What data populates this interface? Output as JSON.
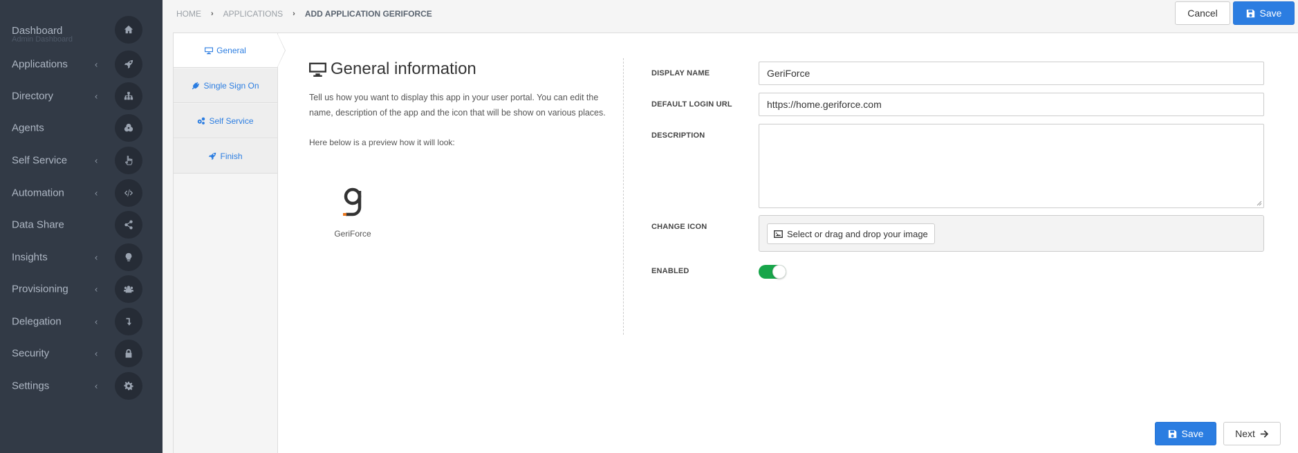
{
  "sidebar": {
    "dashboard": {
      "label": "Dashboard",
      "sub": "Admin Dashboard",
      "icon": "home-icon"
    },
    "items": [
      {
        "label": "Applications",
        "has_chevron": true,
        "icon": "rocket-icon"
      },
      {
        "label": "Directory",
        "has_chevron": true,
        "icon": "sitemap-icon"
      },
      {
        "label": "Agents",
        "has_chevron": false,
        "icon": "cogs-icon"
      },
      {
        "label": "Self Service",
        "has_chevron": true,
        "icon": "hand-pointer-icon"
      },
      {
        "label": "Automation",
        "has_chevron": true,
        "icon": "code-icon"
      },
      {
        "label": "Data Share",
        "has_chevron": false,
        "icon": "share-icon"
      },
      {
        "label": "Insights",
        "has_chevron": true,
        "icon": "lightbulb-icon"
      },
      {
        "label": "Provisioning",
        "has_chevron": true,
        "icon": "users-icon"
      },
      {
        "label": "Delegation",
        "has_chevron": true,
        "icon": "level-down-icon"
      },
      {
        "label": "Security",
        "has_chevron": true,
        "icon": "lock-icon"
      },
      {
        "label": "Settings",
        "has_chevron": true,
        "icon": "gear-icon"
      }
    ],
    "chevron": "‹"
  },
  "breadcrumb": {
    "home": "HOME",
    "applications": "APPLICATIONS",
    "current": "ADD APPLICATION GERIFORCE",
    "sep": "›"
  },
  "header": {
    "cancel_label": "Cancel",
    "save_label": "Save"
  },
  "wizard_tabs": [
    {
      "label": "General",
      "icon": "desktop-icon",
      "active": true
    },
    {
      "label": "Single Sign On",
      "icon": "plug-icon",
      "active": false
    },
    {
      "label": "Self Service",
      "icon": "cogs-icon",
      "active": false
    },
    {
      "label": "Finish",
      "icon": "rocket-icon",
      "active": false
    }
  ],
  "info": {
    "title": "General information",
    "description": "Tell us how you want to display this app in your user portal. You can edit the name, description of the app and the icon that will be show on various places.",
    "preview_label": "Here below is a preview how it will look:",
    "app_name": "GeriForce"
  },
  "form": {
    "display_name_label": "DISPLAY NAME",
    "display_name_value": "GeriForce",
    "login_url_label": "DEFAULT LOGIN URL",
    "login_url_value": "https://home.geriforce.com",
    "description_label": "DESCRIPTION",
    "description_value": "",
    "change_icon_label": "CHANGE ICON",
    "select_image_label": "Select or drag and drop your image",
    "enabled_label": "ENABLED",
    "enabled": true
  },
  "footer": {
    "save_label": "Save",
    "next_label": "Next"
  },
  "colors": {
    "sidebar_bg": "#323a46",
    "primary": "#2b7de1",
    "toggle_on": "#17a54a"
  }
}
